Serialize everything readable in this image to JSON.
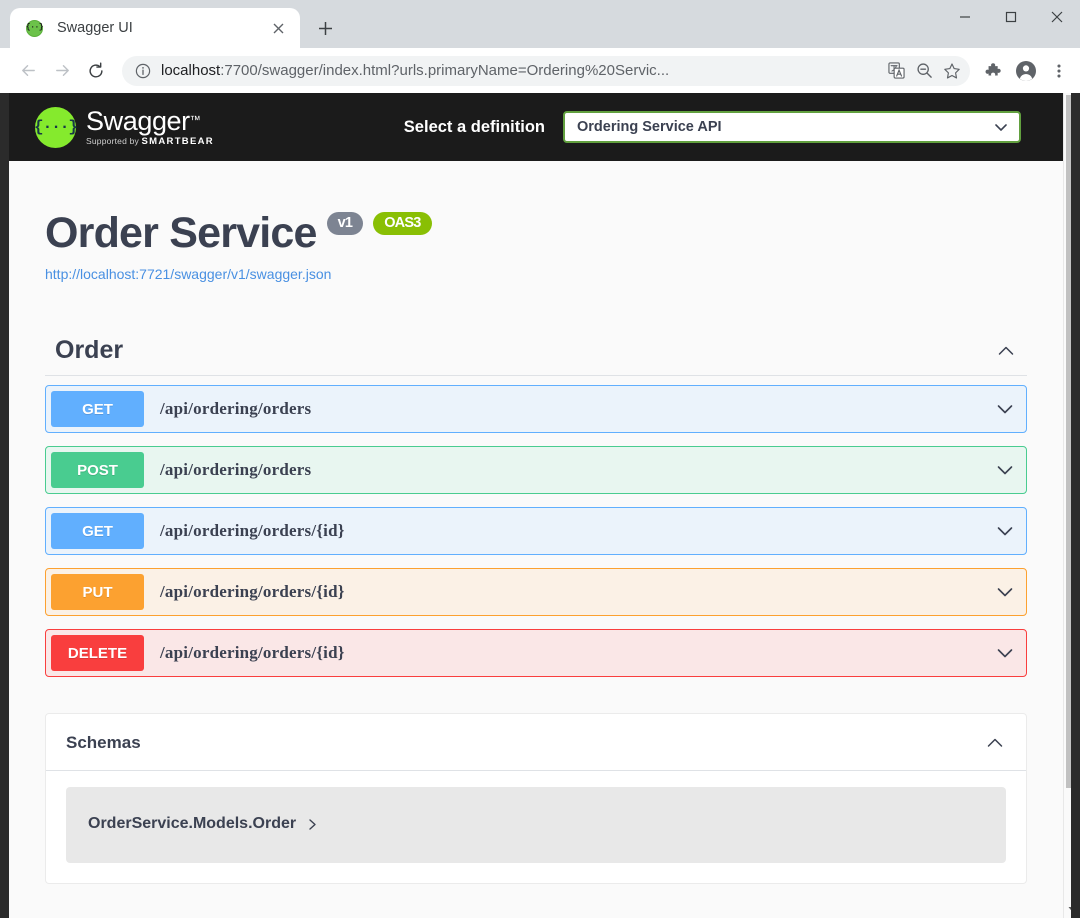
{
  "browser": {
    "tab": {
      "title": "Swagger UI",
      "favicon_icon": "swagger-favicon",
      "close_icon": "close-icon"
    },
    "new_tab_icon": "plus-icon",
    "window_controls": {
      "minimize_icon": "minimize-icon",
      "maximize_icon": "maximize-icon",
      "close_icon": "window-close-icon"
    },
    "nav": {
      "back_icon": "back-arrow-icon",
      "forward_icon": "forward-arrow-icon",
      "reload_icon": "reload-icon"
    },
    "omnibox": {
      "info_icon": "info-circle-icon",
      "url_host": "localhost",
      "url_rest": ":7700/swagger/index.html?urls.primaryName=Ordering%20Servic...",
      "translate_icon": "translate-icon",
      "zoom_out_icon": "zoom-out-icon",
      "bookmark_icon": "star-icon"
    },
    "toolbar": {
      "extensions_icon": "puzzle-icon",
      "profile_icon": "profile-avatar-icon",
      "menu_icon": "three-dot-menu-icon"
    },
    "scrollbar": {
      "down_arrow_icon": "scroll-down-arrow-icon"
    }
  },
  "swagger": {
    "topbar": {
      "logo_glyph": "{···}",
      "logo_name": "Swagger",
      "logo_tm": "™",
      "supported_by": "Supported by",
      "brand": "SMARTBEAR",
      "select_definition_label": "Select a definition",
      "selected_definition": "Ordering Service API",
      "chevron_icon": "chevron-down-icon",
      "accent_green": "#85ea2d",
      "select_border": "#62a03f"
    },
    "info": {
      "title": "Order Service",
      "version_badge": "v1",
      "spec_badge": "OAS3",
      "spec_url": "http://localhost:7721/swagger/v1/swagger.json",
      "version_badge_color": "#7d8492",
      "spec_badge_color": "#89bf04",
      "link_color": "#4990e2"
    },
    "tag": {
      "name": "Order",
      "collapse_icon": "chevron-up-icon",
      "operations": [
        {
          "method": "GET",
          "path": "/api/ordering/orders",
          "class": "get",
          "color": "#61affe",
          "expand_icon": "chevron-down-icon"
        },
        {
          "method": "POST",
          "path": "/api/ordering/orders",
          "class": "post",
          "color": "#49cc90",
          "expand_icon": "chevron-down-icon"
        },
        {
          "method": "GET",
          "path": "/api/ordering/orders/{id}",
          "class": "get",
          "color": "#61affe",
          "expand_icon": "chevron-down-icon"
        },
        {
          "method": "PUT",
          "path": "/api/ordering/orders/{id}",
          "class": "put",
          "color": "#fca130",
          "expand_icon": "chevron-down-icon"
        },
        {
          "method": "DELETE",
          "path": "/api/ordering/orders/{id}",
          "class": "delete",
          "color": "#f93e3e",
          "expand_icon": "chevron-down-icon"
        }
      ]
    },
    "schemas": {
      "title": "Schemas",
      "collapse_icon": "chevron-up-icon",
      "models": [
        {
          "name": "OrderService.Models.Order",
          "expand_icon": "chevron-right-icon"
        }
      ]
    }
  }
}
